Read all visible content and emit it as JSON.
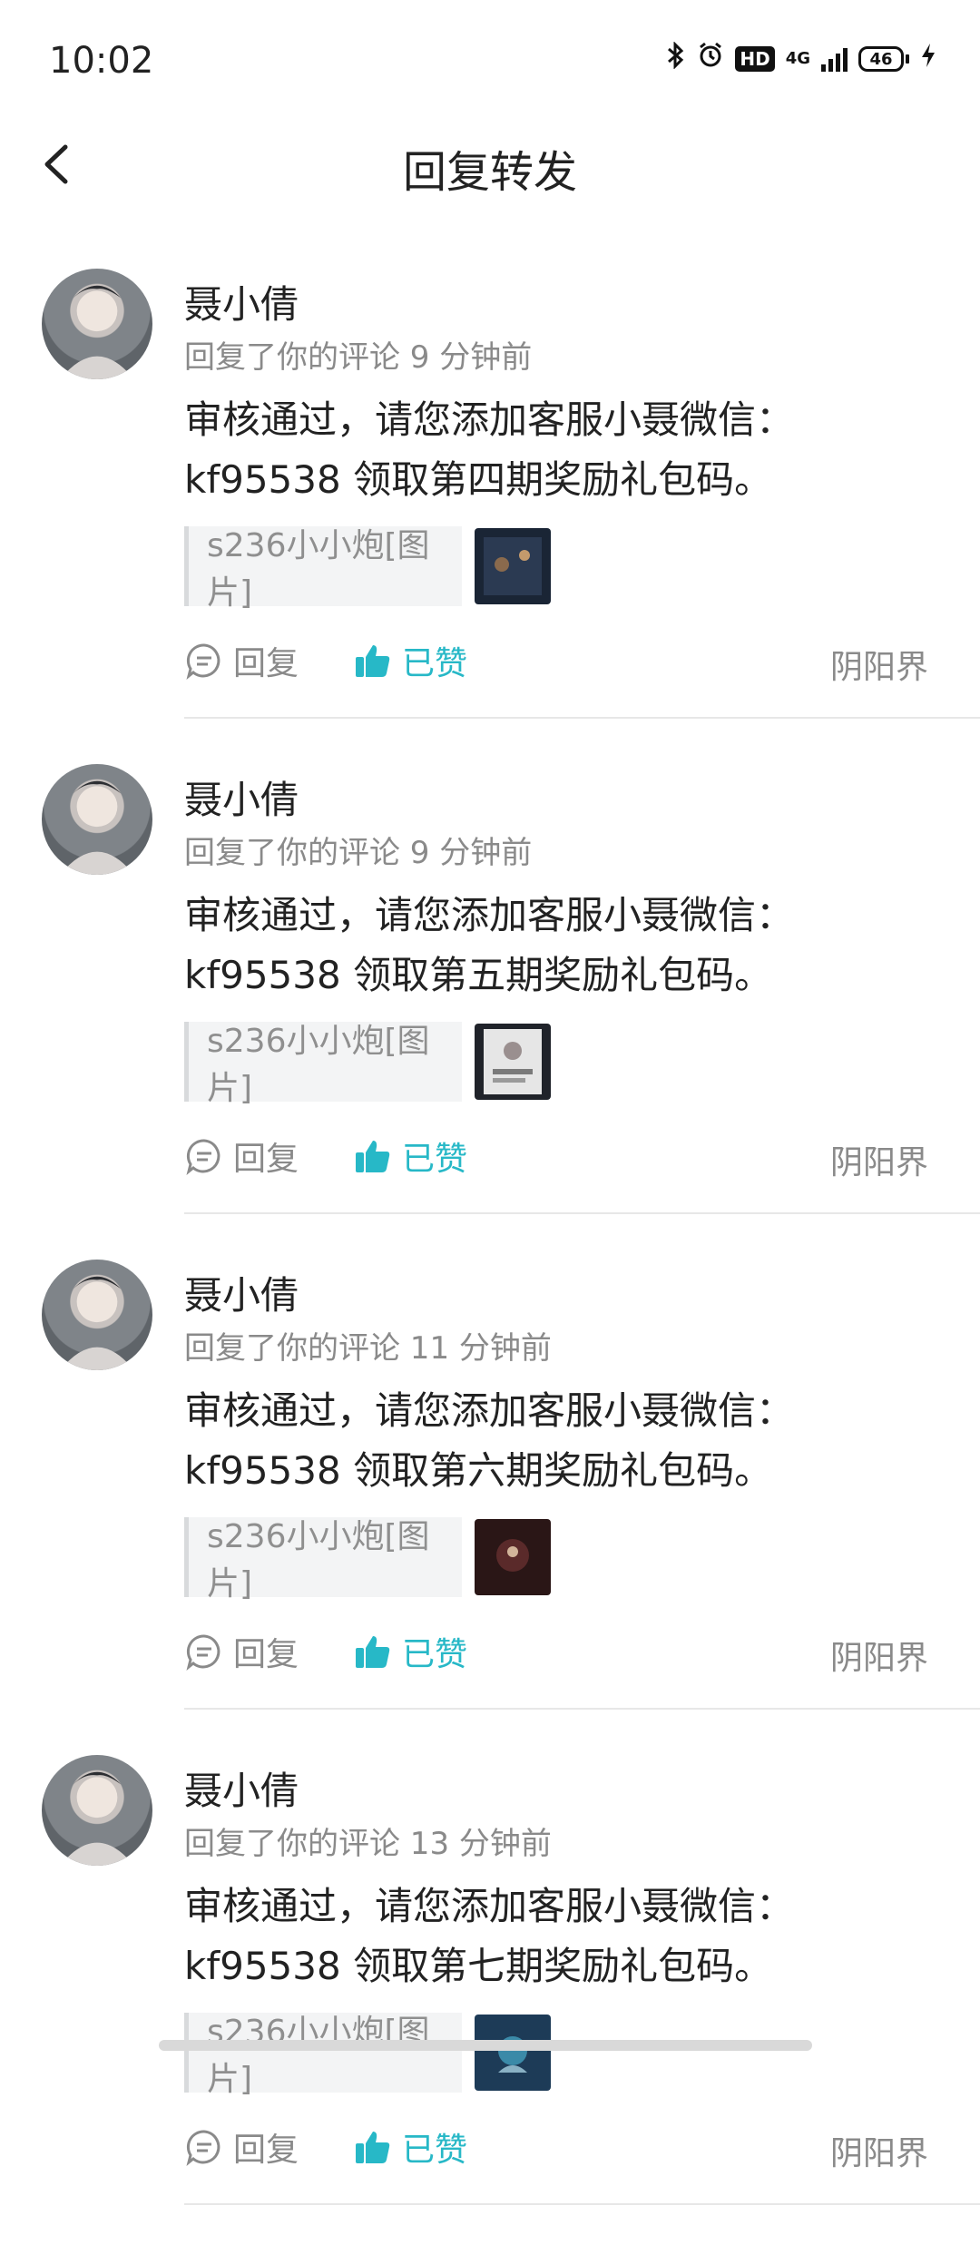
{
  "status": {
    "time": "10:02",
    "network": "4G",
    "battery": "46",
    "icons": [
      "bluetooth-icon",
      "alarm-icon",
      "hd-icon",
      "signal-icon",
      "battery-icon",
      "charging-icon"
    ]
  },
  "header": {
    "title": "回复转发",
    "back_icon": "chevron-left-icon"
  },
  "items": [
    {
      "name": "聂小倩",
      "meta": "回复了你的评论 9 分钟前",
      "content": "审核通过，请您添加客服小聂微信：kf95538 领取第四期奖励礼包码。",
      "quote": "s236小小炮[图片]",
      "reply_label": "回复",
      "like_label": "已赞",
      "source": "阴阳界"
    },
    {
      "name": "聂小倩",
      "meta": "回复了你的评论 9 分钟前",
      "content": "审核通过，请您添加客服小聂微信：kf95538 领取第五期奖励礼包码。",
      "quote": "s236小小炮[图片]",
      "reply_label": "回复",
      "like_label": "已赞",
      "source": "阴阳界"
    },
    {
      "name": "聂小倩",
      "meta": "回复了你的评论 11 分钟前",
      "content": "审核通过，请您添加客服小聂微信：kf95538 领取第六期奖励礼包码。",
      "quote": "s236小小炮[图片]",
      "reply_label": "回复",
      "like_label": "已赞",
      "source": "阴阳界"
    },
    {
      "name": "聂小倩",
      "meta": "回复了你的评论 13 分钟前",
      "content": "审核通过，请您添加客服小聂微信：kf95538 领取第七期奖励礼包码。",
      "quote": "s236小小炮[图片]",
      "reply_label": "回复",
      "like_label": "已赞",
      "source": "阴阳界"
    }
  ],
  "colors": {
    "accent": "#27b8c7",
    "meta_text": "#8a8a8a"
  }
}
